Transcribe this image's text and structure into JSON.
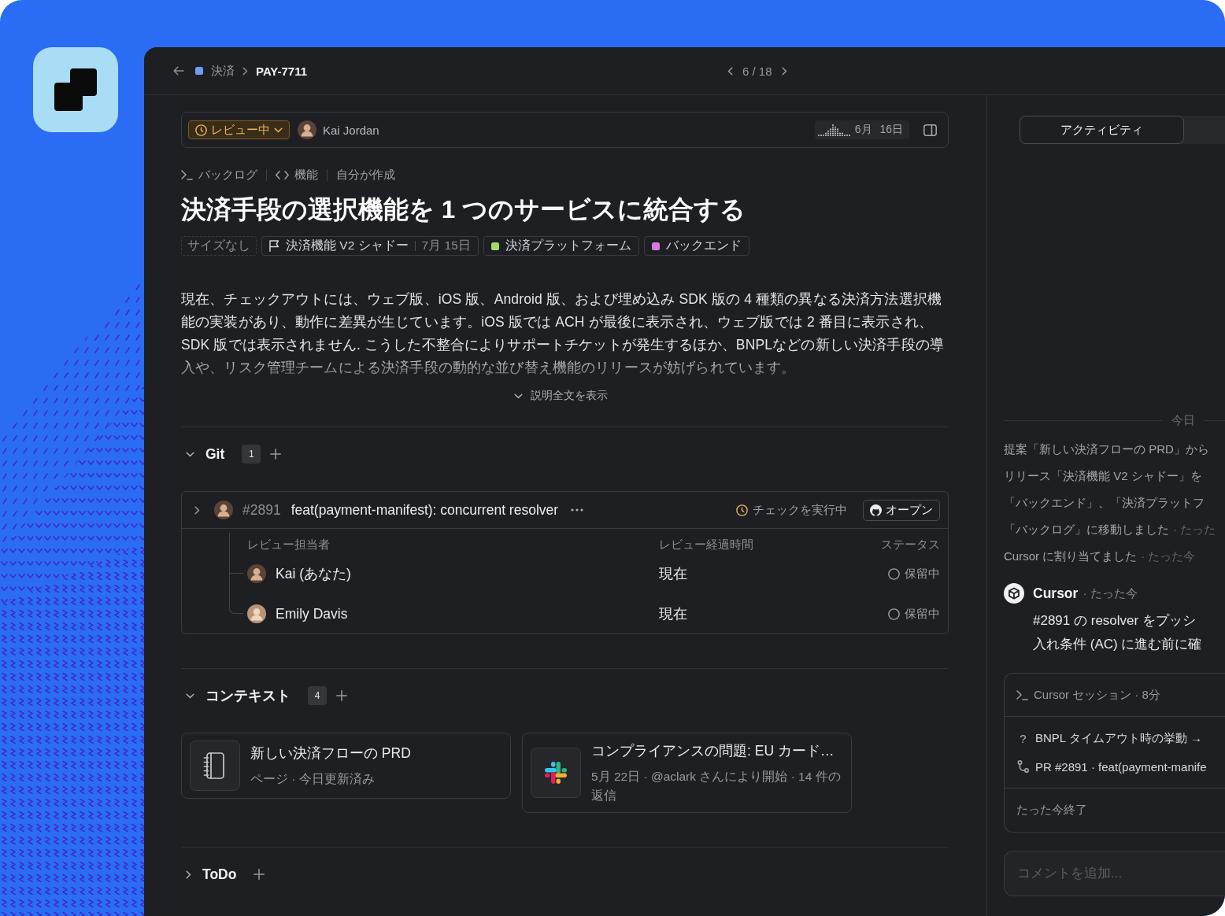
{
  "header": {
    "breadcrumb": [
      "決済",
      "PAY-7711"
    ],
    "pager": "6 / 18"
  },
  "issue_bar": {
    "status": "レビュー中",
    "assignee": "Kai Jordan",
    "due": "6月 16日"
  },
  "meta": [
    {
      "kind": "terminal",
      "label": "バックログ"
    },
    {
      "kind": "code",
      "label": "機能"
    },
    {
      "kind": "plain",
      "label": "自分が作成"
    }
  ],
  "title": "決済手段の選択機能を 1 つのサービスに統合する",
  "tags": [
    {
      "kind": "size",
      "label": "サイズなし"
    },
    {
      "kind": "release",
      "label": "決済機能 V2 シャドー",
      "date": "7月 15日"
    },
    {
      "kind": "label",
      "label": "決済プラットフォーム",
      "color": "#a6d86a"
    },
    {
      "kind": "label",
      "label": "バックエンド",
      "color": "#d77ae0"
    }
  ],
  "description": {
    "text": "現在、チェックアウトには、ウェブ版、iOS 版、Android 版、および埋め込み SDK 版の 4 種類の異なる決済方法選択機能の実装があり、動作に差異が生じています。iOS 版では ACH が最後に表示され、ウェブ版では 2 番目に表示され、SDK 版では表示されません. こうした不整合によりサポートチケットが発生するほか、BNPLなどの新しい決済手段の導入や、リスク管理チームによる決済手段の動的な並び替え機能のリリースが妨げられています。",
    "more": "説明全文を表示"
  },
  "git_section": {
    "title": "Git",
    "count": "1",
    "expanded": true,
    "pull_request": {
      "number": "#2891",
      "title": "feat(payment-manifest): concurrent resolver",
      "checks": "チェックを実行中",
      "open": "オープン",
      "columns": [
        "レビュー担当者",
        "レビュー経過時間",
        "ステータス"
      ],
      "reviewers": [
        {
          "name": "Kai (あなた)",
          "elapsed": "現在",
          "status": "保留中"
        },
        {
          "name": "Emily Davis",
          "elapsed": "現在",
          "status": "保留中"
        }
      ]
    }
  },
  "context_section": {
    "title": "コンテキスト",
    "count": "4",
    "expanded": true,
    "items": [
      {
        "kind": "page",
        "title": "新しい決済フローの PRD",
        "meta": "ページ · 今日更新済み"
      },
      {
        "kind": "thread",
        "title": "コンプライアンスの問題: EU カード…",
        "meta": "5月 22日 · @aclark さんにより開始 · 14 件の返信"
      }
    ]
  },
  "todo_section": {
    "title": "ToDo",
    "expanded": false
  },
  "activity": {
    "tabs": [
      {
        "label": "アクティビティ",
        "selected": true
      }
    ],
    "day": "今日",
    "events": [
      {
        "text": "提案「新しい決済フローの PRD」から"
      },
      {
        "text": "リリース「決済機能 V2 シャドー」を"
      },
      {
        "text": "「バックエンド」、「決済プラットフ"
      },
      {
        "text": "「バックログ」に移動しました",
        "time": "· たった"
      },
      {
        "text": "Cursor に割り当てました",
        "time": "· たった今"
      }
    ],
    "comment": {
      "author": "Cursor",
      "time": "· たった今",
      "lines": [
        "#2891 の resolver をプッシ",
        "入れ条件 (AC) に進む前に確"
      ]
    },
    "session": {
      "title": "Cursor セッション · 8分",
      "items": [
        {
          "kind": "question",
          "marker": "?",
          "text": "BNPL タイムアウト時の挙動 →"
        },
        {
          "kind": "pr",
          "text": "PR #2891 · feat(payment-manife"
        }
      ],
      "footer": "たった今終了"
    },
    "comment_box": {
      "placeholder": "コメントを追加..."
    }
  }
}
